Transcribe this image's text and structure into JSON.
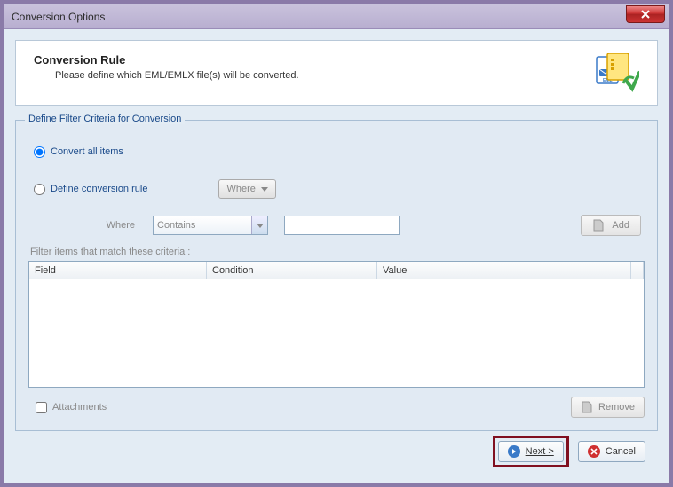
{
  "window": {
    "title": "Conversion Options"
  },
  "header": {
    "title": "Conversion Rule",
    "desc": "Please define which EML/EMLX file(s) will be converted."
  },
  "group": {
    "title": "Define Filter Criteria for Conversion",
    "radio_all": "Convert all items",
    "radio_rule": "Define conversion rule",
    "where_btn": "Where",
    "where_label": "Where",
    "condition_options": [
      "Contains"
    ],
    "condition_selected": "Contains",
    "value_input": "",
    "add_label": "Add",
    "filter_label": "Filter items that match these criteria :",
    "columns": {
      "field": "Field",
      "condition": "Condition",
      "value": "Value"
    },
    "rows": [],
    "attachments_label": "Attachments",
    "attachments_checked": false,
    "remove_label": "Remove"
  },
  "footer": {
    "next": "Next >",
    "cancel": "Cancel"
  }
}
